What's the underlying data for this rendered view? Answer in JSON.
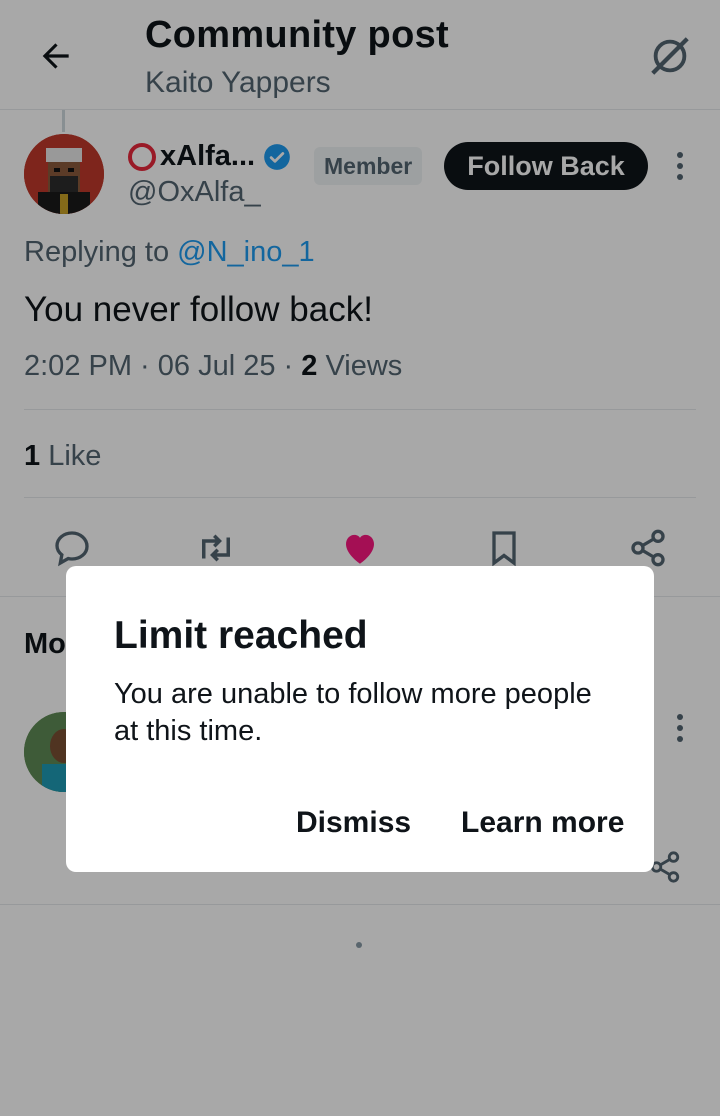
{
  "header": {
    "title": "Community post",
    "subtitle": "Kaito Yappers"
  },
  "post": {
    "display_name": "xAlfa...",
    "handle": "@OxAlfa_",
    "badge": "Member",
    "follow_label": "Follow Back",
    "replying_prefix": "Replying to ",
    "replying_mention": "@N_ino_1",
    "text": "You never follow back!",
    "time": "2:02 PM · 06 Jul 25 · ",
    "views_count": "2",
    "views_label": " Views",
    "like_count": "1",
    "like_label": " Like"
  },
  "more_section": {
    "heading_partial": "Mo"
  },
  "dialog": {
    "title": "Limit reached",
    "body": "You are unable to follow more people at this time.",
    "dismiss_label": "Dismiss",
    "learn_more_label": "Learn more"
  },
  "colors": {
    "accent": "#1d9bf0",
    "like": "#f91880",
    "text": "#0f1419",
    "muted": "#536471"
  }
}
